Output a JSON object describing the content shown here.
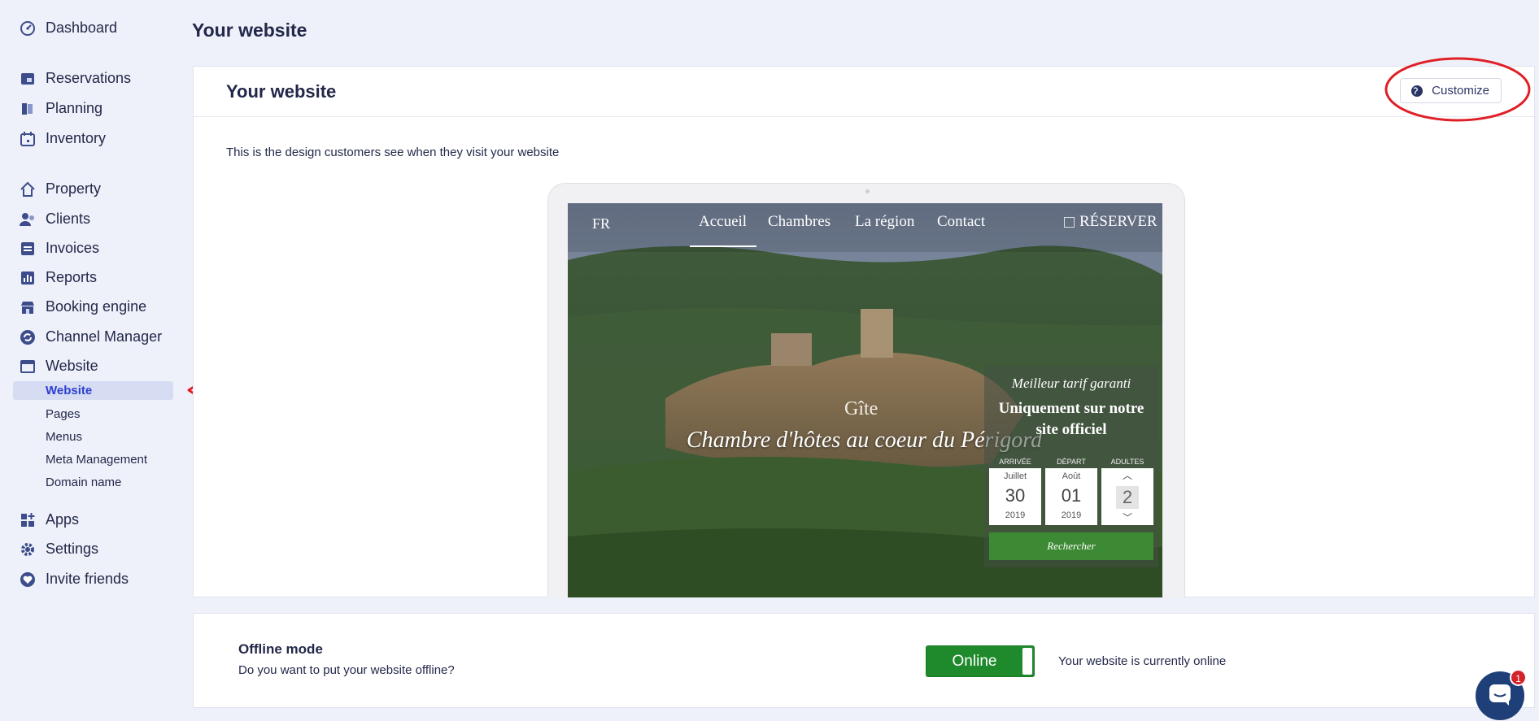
{
  "sidebar": {
    "items": [
      {
        "label": "Dashboard",
        "icon": "dashboard-icon"
      },
      {
        "label": "Reservations",
        "icon": "reservations-icon"
      },
      {
        "label": "Planning",
        "icon": "planning-icon"
      },
      {
        "label": "Inventory",
        "icon": "inventory-icon"
      },
      {
        "label": "Property",
        "icon": "home-icon"
      },
      {
        "label": "Clients",
        "icon": "clients-icon"
      },
      {
        "label": "Invoices",
        "icon": "invoices-icon"
      },
      {
        "label": "Reports",
        "icon": "reports-icon"
      },
      {
        "label": "Booking engine",
        "icon": "booking-engine-icon"
      },
      {
        "label": "Channel Manager",
        "icon": "sync-icon"
      },
      {
        "label": "Website",
        "icon": "browser-window-icon"
      }
    ],
    "website_sub": [
      "Website",
      "Pages",
      "Menus",
      "Meta Management",
      "Domain name"
    ],
    "bottom_items": [
      {
        "label": "Apps",
        "icon": "apps-icon"
      },
      {
        "label": "Settings",
        "icon": "gear-icon"
      },
      {
        "label": "Invite friends",
        "icon": "heart-icon"
      }
    ]
  },
  "header": {
    "title": "Your website"
  },
  "website_card": {
    "title": "Your website",
    "customize_label": "Customize",
    "description": "This is the design customers see when they visit your website"
  },
  "preview": {
    "lang": "FR",
    "nav": [
      "Accueil",
      "Chambres",
      "La région",
      "Contact"
    ],
    "reserve": "RÉSERVER",
    "gite": "Gîte",
    "tagline": "Chambre d'hôtes au coeur du Périgord",
    "booking": {
      "guarantee": "Meilleur tarif garanti",
      "headline_1": "Uniquement sur notre",
      "headline_2": "site officiel",
      "arrival_label": "ARRIVÉE",
      "departure_label": "DÉPART",
      "adults_label": "ADULTES",
      "arrival": {
        "month": "Juillet",
        "day": "30",
        "year": "2019"
      },
      "departure": {
        "month": "Août",
        "day": "01",
        "year": "2019"
      },
      "adults": "2",
      "search_label": "Rechercher"
    }
  },
  "offline": {
    "title": "Offline mode",
    "question": "Do you want to put your website offline?",
    "toggle_label": "Online",
    "status": "Your website is currently online"
  },
  "chat": {
    "badge": "1"
  },
  "colors": {
    "accent": "#2c3fd0",
    "online_green": "#1f8a2b",
    "annotation_red": "#e01f26"
  }
}
